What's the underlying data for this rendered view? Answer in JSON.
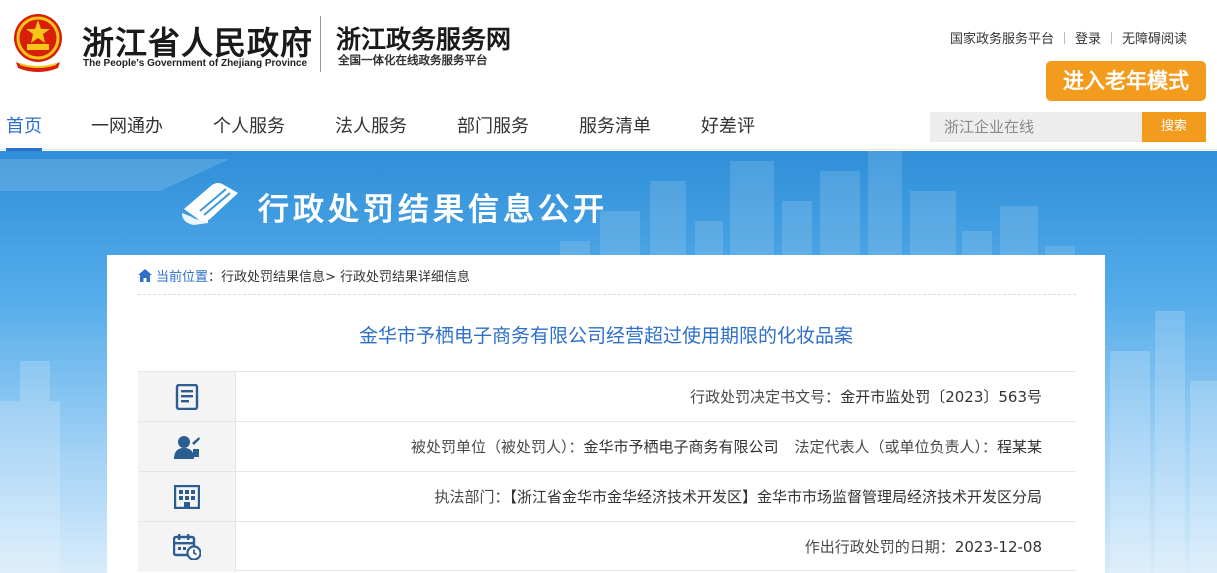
{
  "header": {
    "gov_title": "浙江省人民政府",
    "gov_subtitle": "The People's Government of Zhejiang Province",
    "service_title": "浙江政务服务网",
    "service_subtitle": "全国一体化在线政务服务平台",
    "links": [
      "国家政务服务平台",
      "登录",
      "无障碍阅读"
    ],
    "elder_mode": "进入老年模式"
  },
  "nav": {
    "items": [
      "首页",
      "一网通办",
      "个人服务",
      "法人服务",
      "部门服务",
      "服务清单",
      "好差评"
    ],
    "active_index": 0,
    "search_placeholder": "浙江企业在线",
    "search_button": "搜索"
  },
  "banner": {
    "title": "行政处罚结果信息公开"
  },
  "breadcrumb": {
    "label": "当前位置",
    "colon": "：",
    "items": [
      "行政处罚结果信息>",
      "行政处罚结果详细信息"
    ]
  },
  "case": {
    "title": "金华市予栖电子商务有限公司经营超过使用期限的化妆品案",
    "rows": [
      {
        "icon": "document-list-icon",
        "label": "行政处罚决定书文号：",
        "value": "金开市监处罚〔2023〕563号"
      },
      {
        "icon": "person-icon",
        "label": "被处罚单位（被处罚人）：",
        "value": "金华市予栖电子商务有限公司",
        "extra_label": "法定代表人（或单位负责人）：",
        "extra_value": "程某某"
      },
      {
        "icon": "building-icon",
        "label": "执法部门：",
        "value": "【浙江省金华市金华经济技术开发区】金华市市场监督管理局经济技术开发区分局"
      },
      {
        "icon": "calendar-clock-icon",
        "label": "作出行政处罚的日期：",
        "value": "2023-12-08"
      }
    ]
  },
  "colors": {
    "accent": "#2e6fc9",
    "orange": "#f29b1c",
    "banner_top": "#2f8fd8"
  }
}
